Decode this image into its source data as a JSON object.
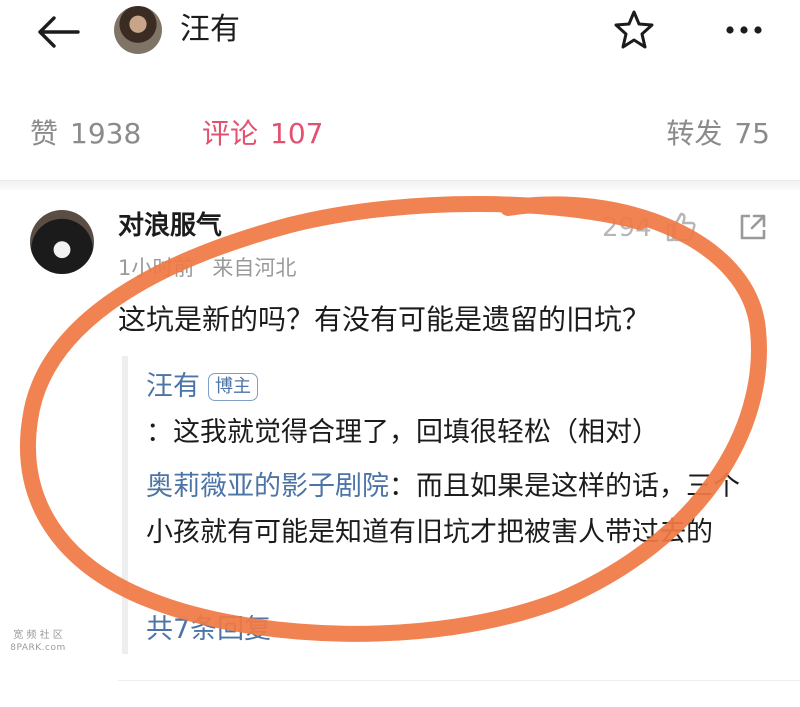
{
  "header": {
    "back_icon": "arrow-left-icon",
    "author_name": "汪有",
    "favorite_icon": "star-icon",
    "more_icon": "ellipsis-icon"
  },
  "stats": {
    "likes_label": "赞",
    "likes_count": "1938",
    "comments_label": "评论",
    "comments_count": "107",
    "reposts_label": "转发",
    "reposts_count": "75",
    "active_tab_color": "#e4506f"
  },
  "comment": {
    "username": "对浪服气",
    "like_count": "294",
    "like_icon": "thumbs-up-icon",
    "share_icon": "share-icon",
    "time": "1小时前",
    "location": "来自河北",
    "text": "这坑是新的吗？有没有可能是遗留的旧坑？",
    "replies": [
      {
        "author": "汪有",
        "badge": "博主",
        "text": "：这我就觉得合理了，回填很轻松（相对）"
      },
      {
        "author": "奥莉薇亚的影子剧院",
        "text": "：而且如果是这样的话，三个小孩就有可能是知道有旧坑才把被害人带过去的"
      }
    ],
    "more_replies": "共7条回复",
    "link_color": "#4d74a6"
  },
  "watermark": {
    "text": "宽 频 社 区",
    "sub": "8PARK.com"
  },
  "annotation": {
    "color": "#f07a45"
  }
}
